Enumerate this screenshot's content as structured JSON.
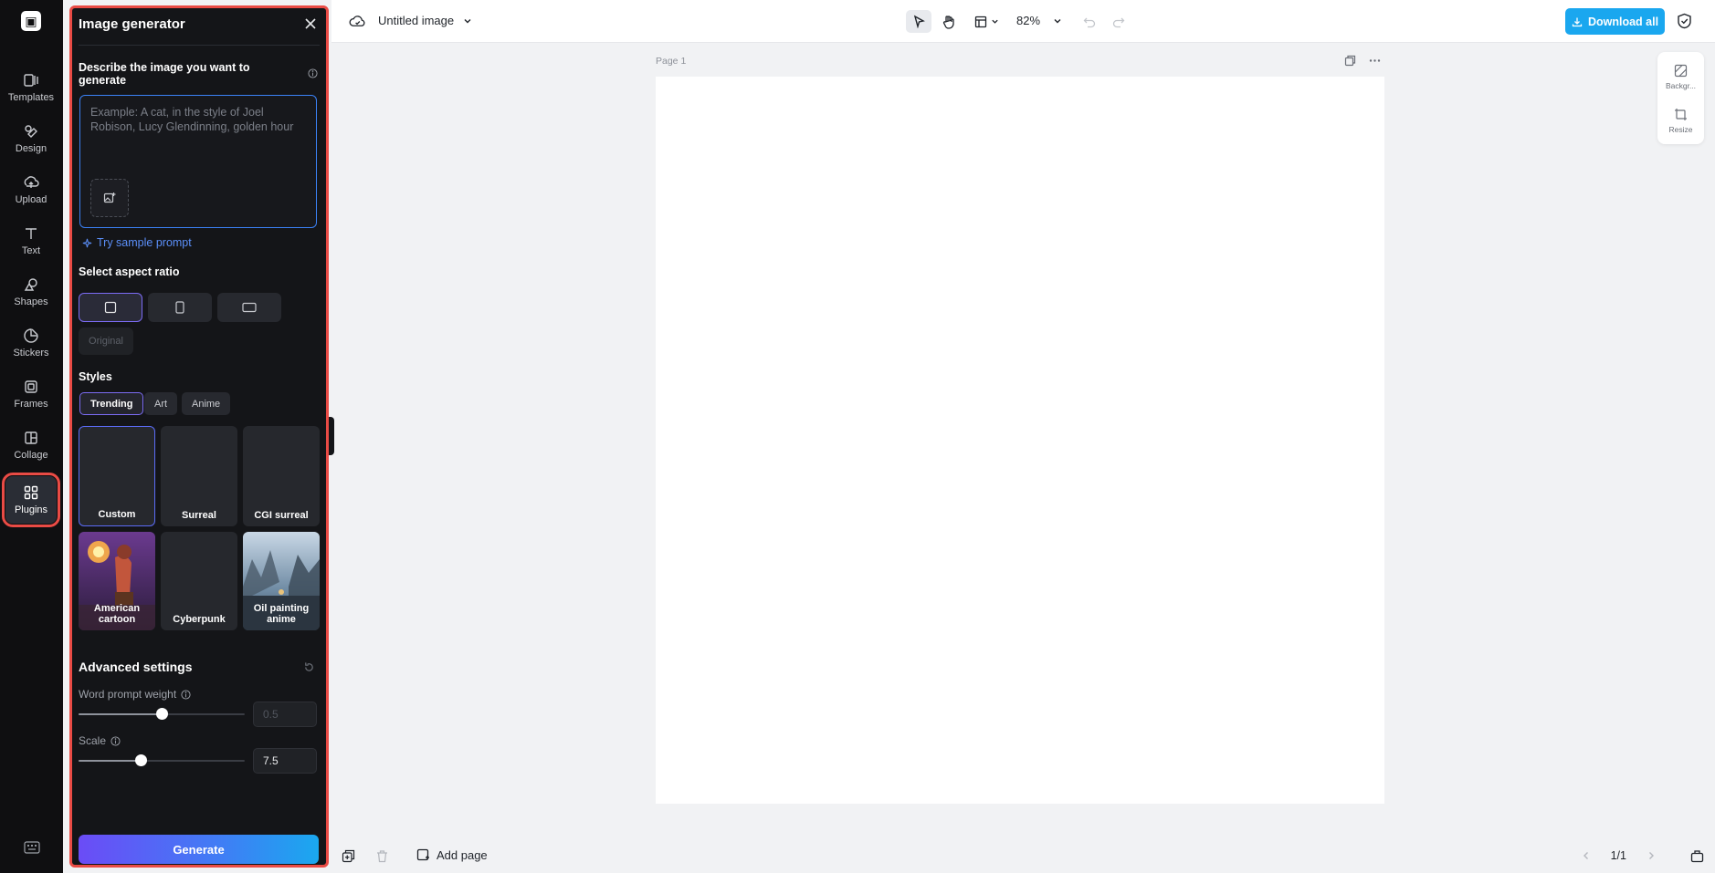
{
  "rail": {
    "items": [
      {
        "label": "Templates",
        "icon": "templates-icon"
      },
      {
        "label": "Design",
        "icon": "design-icon"
      },
      {
        "label": "Upload",
        "icon": "upload-icon"
      },
      {
        "label": "Text",
        "icon": "text-icon"
      },
      {
        "label": "Shapes",
        "icon": "shapes-icon"
      },
      {
        "label": "Stickers",
        "icon": "stickers-icon"
      },
      {
        "label": "Frames",
        "icon": "frames-icon"
      },
      {
        "label": "Collage",
        "icon": "collage-icon"
      },
      {
        "label": "Plugins",
        "icon": "plugins-icon"
      }
    ]
  },
  "panel": {
    "title": "Image generator",
    "describe_label": "Describe the image you want to generate",
    "prompt_placeholder": "Example: A cat, in the style of Joel Robison, Lucy Glendinning, golden hour",
    "prompt_value": "",
    "sample_prompt": "Try sample prompt",
    "aspect_label": "Select aspect ratio",
    "aspect_original": "Original",
    "styles_label": "Styles",
    "style_tabs": [
      "Trending",
      "Art",
      "Anime"
    ],
    "style_cards": [
      "Custom",
      "Surreal",
      "CGI surreal",
      "American cartoon",
      "Cyberpunk",
      "Oil painting anime"
    ],
    "advanced_title": "Advanced settings",
    "word_weight_label": "Word prompt weight",
    "word_weight_value": "0.5",
    "word_weight_fraction": 0.5,
    "scale_label": "Scale",
    "scale_value": "7.5",
    "scale_fraction": 0.375,
    "generate": "Generate"
  },
  "topbar": {
    "doc_title": "Untitled image",
    "zoom": "82%",
    "download": "Download all"
  },
  "canvas": {
    "page_label": "Page 1"
  },
  "side_tools": {
    "background": "Backgr...",
    "resize": "Resize"
  },
  "bottombar": {
    "add_page": "Add page",
    "pager": "1/1"
  },
  "colors": {
    "accent": "#1aa7ef",
    "panel_bg": "#141518",
    "highlight": "#e94b45"
  }
}
